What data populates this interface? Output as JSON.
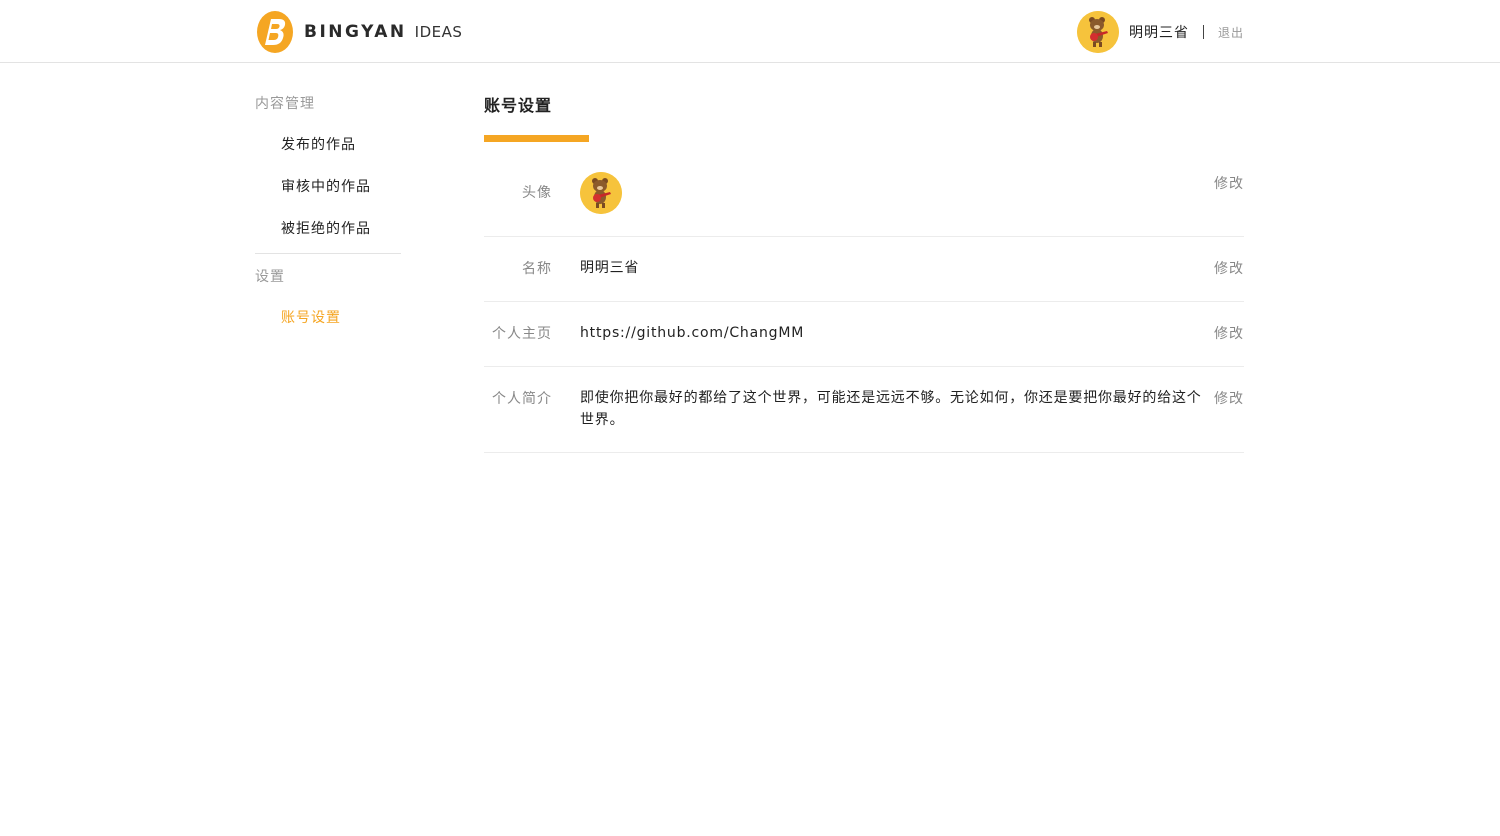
{
  "header": {
    "brand": "BINGYAN",
    "brand_sub": "IDEAS",
    "user_name": "明明三省",
    "logout_label": "退出"
  },
  "sidebar": {
    "groups": [
      {
        "title": "内容管理",
        "items": [
          {
            "label": "发布的作品"
          },
          {
            "label": "审核中的作品"
          },
          {
            "label": "被拒绝的作品"
          }
        ]
      },
      {
        "title": "设置",
        "items": [
          {
            "label": "账号设置",
            "active": true
          }
        ]
      }
    ]
  },
  "main": {
    "title": "账号设置",
    "rows": [
      {
        "label": "头像",
        "value": "",
        "edit": "修改"
      },
      {
        "label": "名称",
        "value": "明明三省",
        "edit": "修改"
      },
      {
        "label": "个人主页",
        "value": "https://github.com/ChangMM",
        "edit": "修改"
      },
      {
        "label": "个人简介",
        "value": "即使你把你最好的都给了这个世界，可能还是远远不够。无论如何，你还是要把你最好的给这个世界。",
        "edit": "修改"
      }
    ]
  },
  "colors": {
    "accent": "#f5a623",
    "avatar_bg": "#f6c33c",
    "divider": "#e3e3e3",
    "muted_text": "#888888"
  },
  "icons": {
    "logo": "bingyan-logo-icon",
    "avatar": "bear-avatar-icon"
  }
}
